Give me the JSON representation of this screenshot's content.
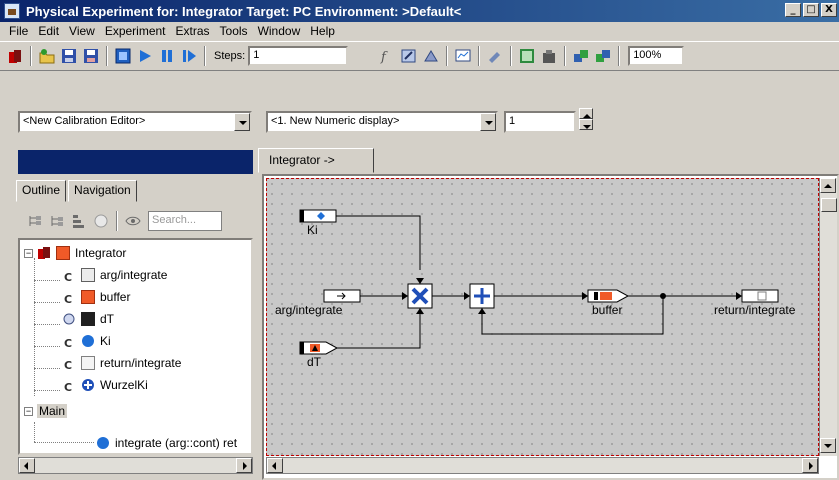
{
  "window": {
    "title": "Physical Experiment for: Integrator  Target: PC  Environment: >Default<",
    "buttons": [
      "_",
      "□",
      "X"
    ]
  },
  "menu": [
    "File",
    "Edit",
    "View",
    "Experiment",
    "Extras",
    "Tools",
    "Window",
    "Help"
  ],
  "toolbar": {
    "steps_label": "Steps:",
    "steps_value": "1",
    "zoom_value": "100%"
  },
  "selectors": {
    "calibration_editor": "<New Calibration Editor>",
    "numeric_display": "<1. New Numeric display>",
    "spin_value": "1"
  },
  "left_panel": {
    "tabs": [
      "Outline",
      "Navigation"
    ],
    "search_placeholder": "Search...",
    "tree": {
      "root": "Integrator",
      "children": [
        "arg/integrate",
        "buffer",
        "dT",
        "Ki",
        "return/integrate",
        "WurzelKi"
      ],
      "main": "Main",
      "main_children": [
        "integrate (arg::cont) ret"
      ]
    }
  },
  "diagram": {
    "tab": "Integrator ->",
    "blocks": {
      "ki": "Ki",
      "arg": "arg/integrate",
      "dt": "dT",
      "buffer": "buffer",
      "ret": "return/integrate"
    }
  },
  "colors": {
    "title_bar_start": "#0a246a",
    "title_bar_end": "#3a6ea5",
    "canvas_bg": "#c8c8c8",
    "selection_dash": "#c00000",
    "orange_block": "#f05a28",
    "blue_block": "#1f6fd6"
  }
}
